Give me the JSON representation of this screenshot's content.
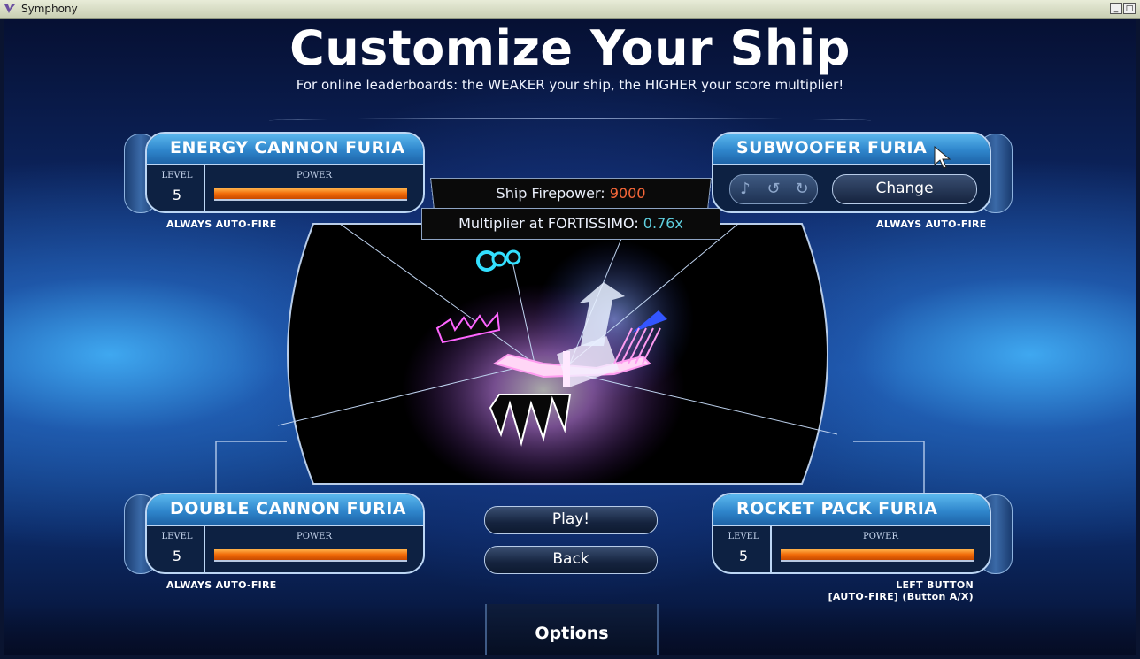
{
  "window": {
    "title": "Symphony",
    "minimize_label": "_",
    "maximize_label": "□"
  },
  "header": {
    "title": "Customize Your Ship",
    "subtitle": "For online leaderboards: the WEAKER your ship, the HIGHER your score multiplier!"
  },
  "weapons": [
    {
      "name": "ENERGY CANNON FURIA",
      "level_label": "LEVEL",
      "level": "5",
      "power_label": "POWER",
      "power": 1.0,
      "note": "ALWAYS AUTO-FIRE"
    },
    {
      "name": "SUBWOOFER FURIA",
      "change_label": "Change",
      "note": "ALWAYS AUTO-FIRE",
      "icons": [
        "music-note-icon",
        "rotate-left-icon",
        "rotate-right-icon"
      ]
    },
    {
      "name": "DOUBLE CANNON FURIA",
      "level_label": "LEVEL",
      "level": "5",
      "power_label": "POWER",
      "power": 1.0,
      "note": "ALWAYS AUTO-FIRE"
    },
    {
      "name": "ROCKET PACK FURIA",
      "level_label": "LEVEL",
      "level": "5",
      "power_label": "POWER",
      "power": 1.0,
      "note_line1": "LEFT BUTTON",
      "note_line2": "[AUTO-FIRE] (Button A/X)"
    }
  ],
  "stats": {
    "firepower_label": "Ship Firepower:",
    "firepower_value": "9000",
    "multiplier_label": "Multiplier at FORTISSIMO:",
    "multiplier_value": "0.76x"
  },
  "buttons": {
    "play": "Play!",
    "back": "Back",
    "options": "Options"
  },
  "colors": {
    "accent_orange": "#f06a08",
    "multiplier_cyan": "#5fd0e0",
    "firepower_red": "#ff6a3a",
    "panel_blue": "#2f86cc"
  }
}
